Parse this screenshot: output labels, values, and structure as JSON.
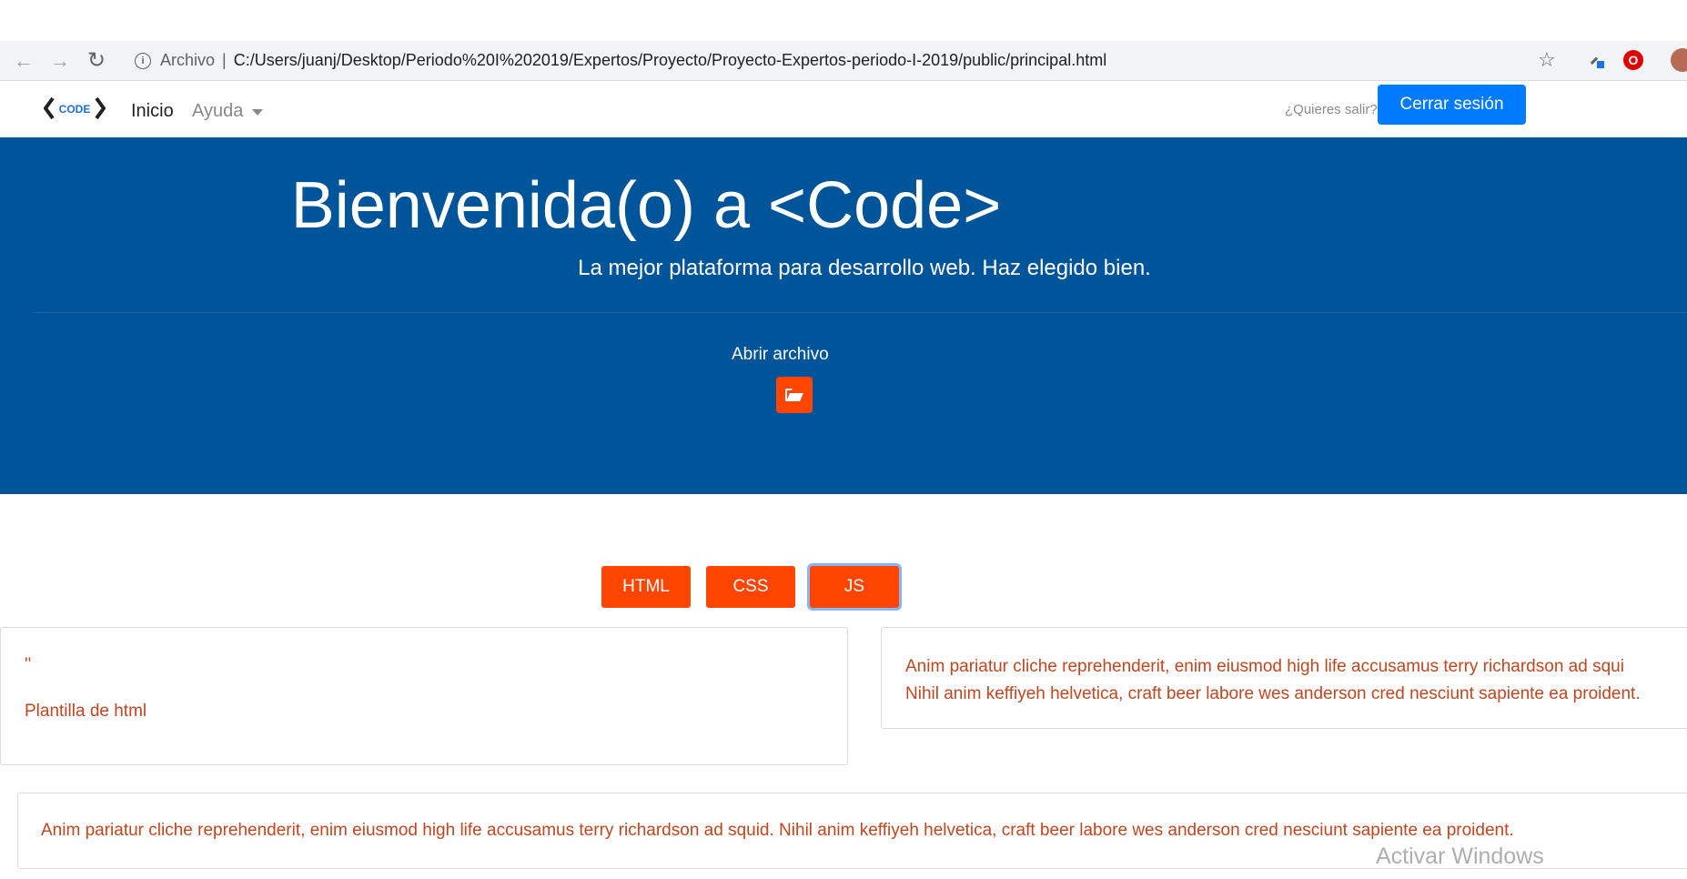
{
  "browser": {
    "chip": "Archivo",
    "url": "C:/Users/juanj/Desktop/Periodo%20I%202019/Expertos/Proyecto/Proyecto-Expertos-periodo-I-2019/public/principal.html"
  },
  "navbar": {
    "logo_text": "CODE",
    "links": [
      "Inicio",
      "Ayuda"
    ],
    "logout_prompt": "¿Quieres salir?",
    "logout_label": "Cerrar sesión"
  },
  "hero": {
    "title": "Bienvenida(o) a <Code>",
    "subtitle": "La mejor plataforma para desarrollo web. Haz elegido bien.",
    "open_label": "Abrir archivo"
  },
  "tabs": [
    "HTML",
    "CSS",
    "JS"
  ],
  "cards": {
    "card1_quote": "''",
    "card1_text": "Plantilla de html",
    "card2_text": "Anim pariatur cliche reprehenderit, enim eiusmod high life accusamus terry richardson ad squi Nihil anim keffiyeh helvetica, craft beer labore wes anderson cred nesciunt sapiente ea proident.",
    "card3_text": "Anim pariatur cliche reprehenderit, enim eiusmod high life accusamus terry richardson ad squid. Nihil anim keffiyeh helvetica, craft beer labore wes anderson cred nesciunt sapiente ea proident."
  },
  "watermark": "Activar Windows",
  "colors": {
    "hero_bg": "#00549a",
    "accent_orange": "#ff4500",
    "primary_blue": "#007bff",
    "card_text": "#c0471f"
  },
  "icons": [
    "back-icon",
    "forward-icon",
    "reload-icon",
    "info-icon",
    "star-icon",
    "extension-icon",
    "opera-icon",
    "folder-open-icon"
  ]
}
